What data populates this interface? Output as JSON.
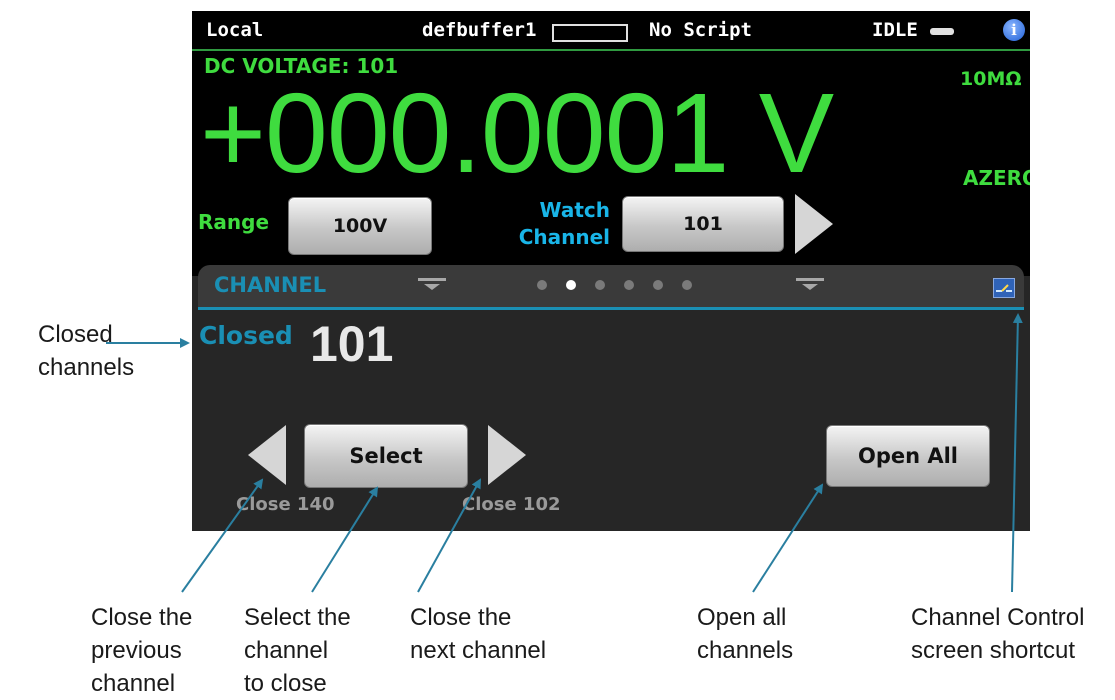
{
  "status_bar": {
    "mode": "Local",
    "buffer": "defbuffer1",
    "script": "No Script",
    "state": "IDLE"
  },
  "measurement": {
    "function_label": "DC VOLTAGE: 101",
    "reading": "+000.0001 V",
    "impedance": "10MΩ",
    "autozero": "AZERO",
    "range_label": "Range",
    "range_value": "100V",
    "watch_label_line1": "Watch",
    "watch_label_line2": "Channel",
    "watch_value": "101"
  },
  "swipe": {
    "title": "CHANNEL",
    "page_count": 6,
    "active_page": 2
  },
  "channel_panel": {
    "closed_label": "Closed",
    "closed_value": "101",
    "select_label": "Select",
    "prev_caption": "Close 140",
    "next_caption": "Close 102",
    "open_all_label": "Open All"
  },
  "annotations": {
    "closed_channels": [
      "Closed",
      "channels"
    ],
    "close_previous": [
      "Close the",
      "previous",
      "channel"
    ],
    "select_channel": [
      "Select the",
      "channel",
      "to close"
    ],
    "close_next": [
      "Close the",
      "next channel"
    ],
    "open_all": [
      "Open all",
      "channels"
    ],
    "shortcut": [
      "Channel Control",
      "screen shortcut"
    ]
  },
  "colors": {
    "reading_green": "#3fdc3f",
    "label_blue": "#1a8fb4",
    "arrow_teal": "#2a7fa0"
  },
  "icons": {
    "status_indicator": "dash-indicator-icon",
    "info": "info-icon",
    "shortcut": "channel-control-shortcut-icon"
  }
}
